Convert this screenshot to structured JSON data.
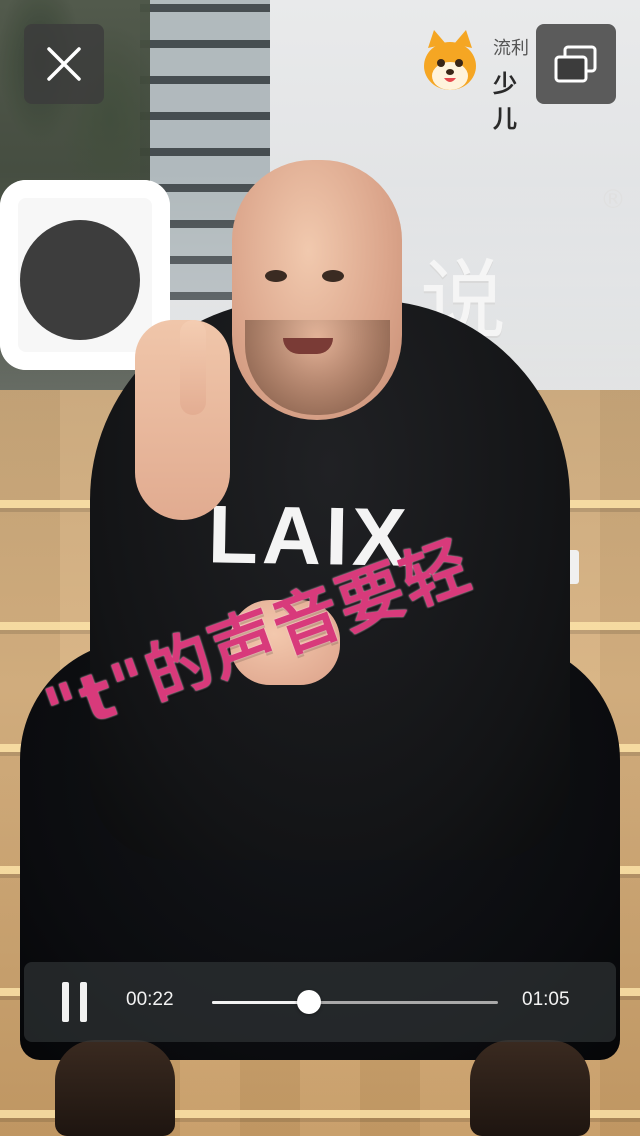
{
  "brand": {
    "line1": "流利",
    "line2": "少儿",
    "mascot_icon": "fox-mascot-icon"
  },
  "background": {
    "shirt_text": "LAIX",
    "wall_sign_text": "说",
    "wall_sign_mark": "®"
  },
  "subtitle": {
    "text": "\"t\"的声音要轻",
    "color": "#d83a7b"
  },
  "top_controls": {
    "close_icon": "close-icon",
    "pip_icon": "picture-in-picture-icon"
  },
  "player": {
    "state_icon": "pause-icon",
    "current_time": "00:22",
    "total_time": "01:05",
    "progress_fraction": 0.34
  }
}
